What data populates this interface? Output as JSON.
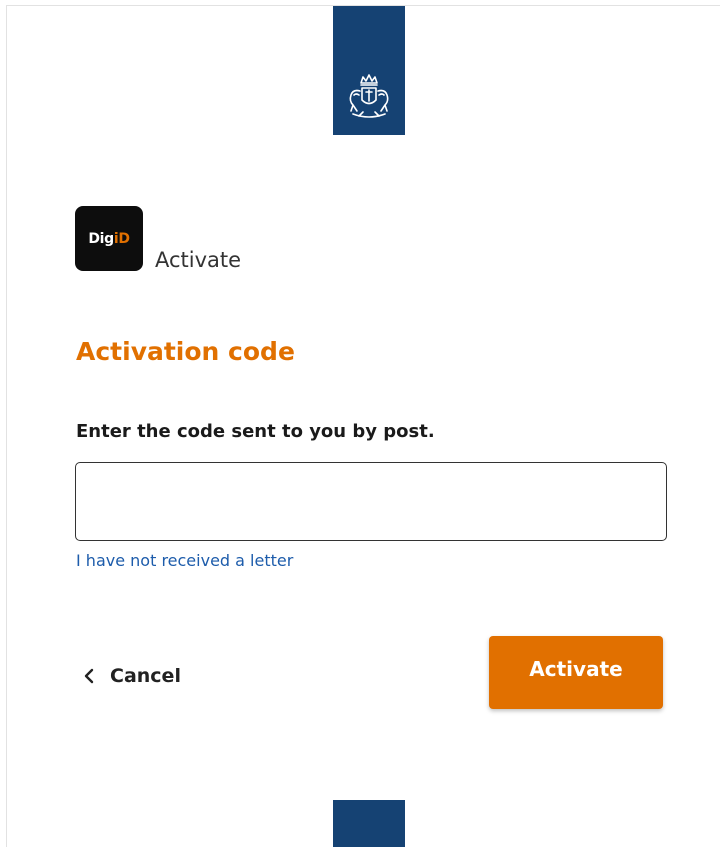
{
  "header": {
    "emblem_icon": "coat-of-arms-icon"
  },
  "app": {
    "logo_dig": "Dig",
    "logo_id": "iD",
    "name": "Activate"
  },
  "form": {
    "title": "Activation code",
    "label": "Enter the code sent to you by post.",
    "input_value": "",
    "input_placeholder": "",
    "no_letter_link": "I have not received a letter"
  },
  "actions": {
    "cancel_icon": "chevron-left-icon",
    "cancel_label": "Cancel",
    "activate_label": "Activate"
  },
  "colors": {
    "brand_blue": "#154273",
    "accent_orange": "#e17000",
    "link_blue": "#1d5cab"
  }
}
